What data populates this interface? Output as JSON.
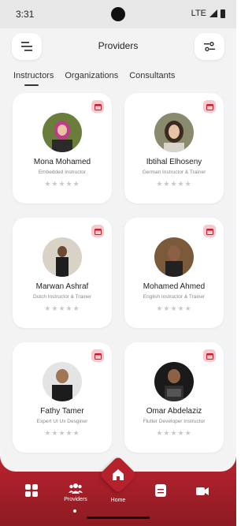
{
  "status": {
    "time": "3:31",
    "network": "LTE"
  },
  "header": {
    "title": "Providers",
    "menu_icon": "menu-icon",
    "filter_icon": "sliders-icon"
  },
  "tabs": [
    {
      "label": "Instructors",
      "active": true
    },
    {
      "label": "Organizations",
      "active": false
    },
    {
      "label": "Consultants",
      "active": false
    }
  ],
  "providers": [
    {
      "name": "Mona Mohamed",
      "role": "Embedded Instructor",
      "stars": "★★★★★"
    },
    {
      "name": "Ibtihal Elhoseny",
      "role": "German Instructor & Trainer",
      "stars": "★★★★★"
    },
    {
      "name": "Marwan Ashraf",
      "role": "Dutch Instructor & Trainer",
      "stars": "★★★★★"
    },
    {
      "name": "Mohamed Ahmed",
      "role": "English Instructor & Trainer",
      "stars": "★★★★★"
    },
    {
      "name": "Fathy Tamer",
      "role": "Expert UI Ux Desginer",
      "stars": "★★★★★"
    },
    {
      "name": "Omar Abdelaziz",
      "role": "Flutter Developer Instructor",
      "stars": "★★★★★"
    }
  ],
  "nav": {
    "providers_label": "Providers",
    "home_label": "Home"
  },
  "colors": {
    "accent": "#b6222c",
    "badge": "#f7c8cc",
    "background": "#f3f3f3"
  }
}
